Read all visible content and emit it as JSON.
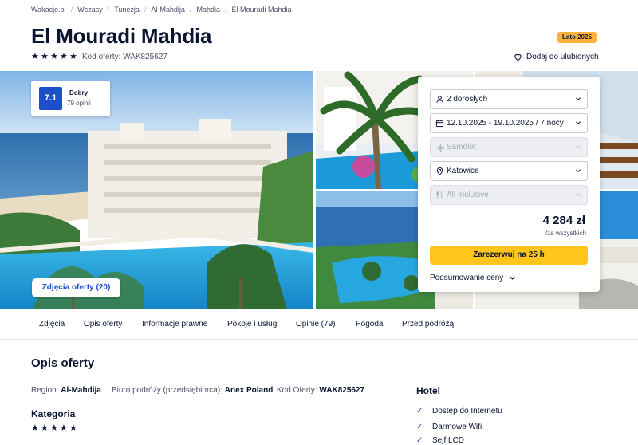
{
  "breadcrumb": [
    "Wakacje.pl",
    "Wczasy",
    "Tunezja",
    "Al-Mahdija",
    "Mahdia",
    "El Mouradi Mahdia"
  ],
  "hotel": {
    "name": "El Mouradi Mahdia",
    "stars": 5,
    "code_label": "Kod oferty: WAK825627",
    "season_badge": "Lato 2025",
    "favorite_label": "Dodaj do ulubionych"
  },
  "rating": {
    "score": "7.1",
    "label": "Dobry",
    "reviews": "79 opinii"
  },
  "gallery": {
    "photos_button": "Zdjęcia oferty (20)"
  },
  "booking": {
    "guests": "2 dorosłych",
    "dates": "12.10.2025 - 19.10.2025 / 7 nocy",
    "transport": "Samolot",
    "departure": "Katowice",
    "board": "All Inclusive",
    "price": "4 284 zł",
    "price_note": "/za wszystkich",
    "book_button": "Zarezerwuj na 25 h",
    "summary_label": "Podsumowanie ceny"
  },
  "tabs": [
    "Zdjęcia",
    "Opis oferty",
    "Informacje prawne",
    "Pokoje i usługi",
    "Opinie (79)",
    "Pogoda",
    "Przed podróżą"
  ],
  "offer": {
    "heading": "Opis oferty",
    "region_label": "Region:",
    "region": "Al-Mahdija",
    "agency_label": "Biuro podróży (przedsiębiorca):",
    "agency": "Anex Poland",
    "code_label": "Kod Oferty:",
    "code": "WAK825627",
    "category_heading": "Kategoria"
  },
  "hotel_features": {
    "heading": "Hotel",
    "items": [
      "Dostęp do Internetu",
      "Darmowe Wifi",
      "Sejf LCD"
    ]
  },
  "colors": {
    "accent": "#1d4fc9",
    "book": "#ffc51a",
    "badge": "#ffb13b"
  }
}
